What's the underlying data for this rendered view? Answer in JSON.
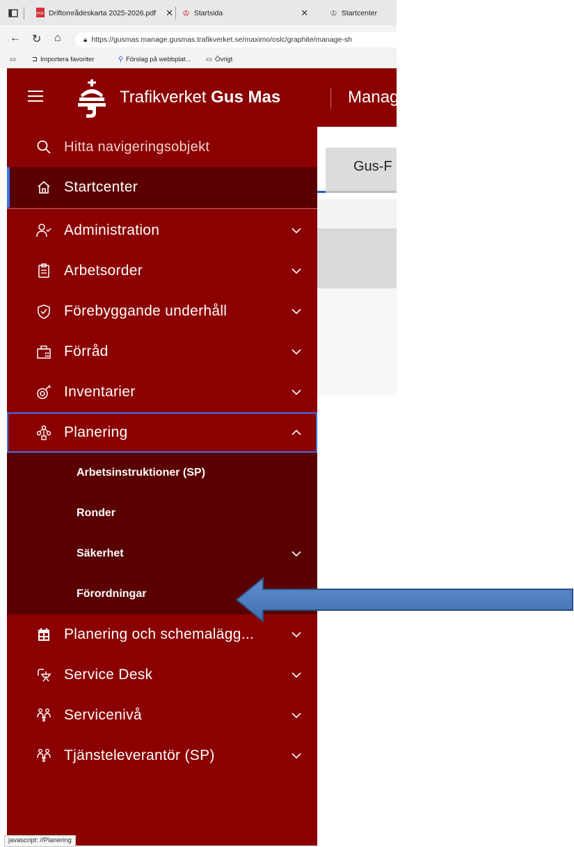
{
  "browser": {
    "tabs": [
      {
        "title": "Driftområdeskarta 2025-2026.pdf",
        "icon": "pdf-icon"
      },
      {
        "title": "Startsida",
        "icon": "trafikverket-icon"
      },
      {
        "title": "Startcenter",
        "icon": "app-icon"
      }
    ],
    "url": "https://gusmas.manage.gusmas.trafikverket.se/maximo/oslc/graphite/manage-sh",
    "favorites": [
      "Importera favoriter",
      "Förslag på webbplat...",
      "Övrigt"
    ]
  },
  "topbar": {
    "brand_name": "Trafikverket",
    "brand_product": "Gus Mas",
    "app_name": "Manag"
  },
  "content": {
    "tab_label": "Gus-F"
  },
  "sidenav": {
    "search_placeholder": "Hitta navigeringsobjekt",
    "home": {
      "label": "Startcenter",
      "icon": "home-icon"
    },
    "items": [
      {
        "label": "Administration",
        "icon": "user-check-icon"
      },
      {
        "label": "Arbetsorder",
        "icon": "clipboard-icon"
      },
      {
        "label": "Förebyggande underhåll",
        "icon": "shield-check-icon"
      },
      {
        "label": "Förråd",
        "icon": "storage-icon"
      },
      {
        "label": "Inventarier",
        "icon": "asset-icon"
      },
      {
        "label": "Planering",
        "icon": "hierarchy-icon",
        "expanded": true
      },
      {
        "label": "Planering och schemalägg...",
        "icon": "calendar-icon"
      },
      {
        "label": "Service Desk",
        "icon": "service-desk-icon"
      },
      {
        "label": "Servicenivå",
        "icon": "service-level-icon"
      },
      {
        "label": "Tjänsteleverantör (SP)",
        "icon": "service-provider-icon"
      }
    ],
    "planering_subitems": [
      {
        "label": "Arbetsinstruktioner (SP)"
      },
      {
        "label": "Ronder"
      },
      {
        "label": "Säkerhet",
        "has_children": true
      },
      {
        "label": "Förordningar"
      }
    ]
  },
  "status_bar": "javascript: //Planering",
  "colors": {
    "brand_red": "#8b0000",
    "submenu_red": "#5a0000",
    "focus_blue": "#3b72e6",
    "arrow_blue": "#4f7fc0"
  }
}
